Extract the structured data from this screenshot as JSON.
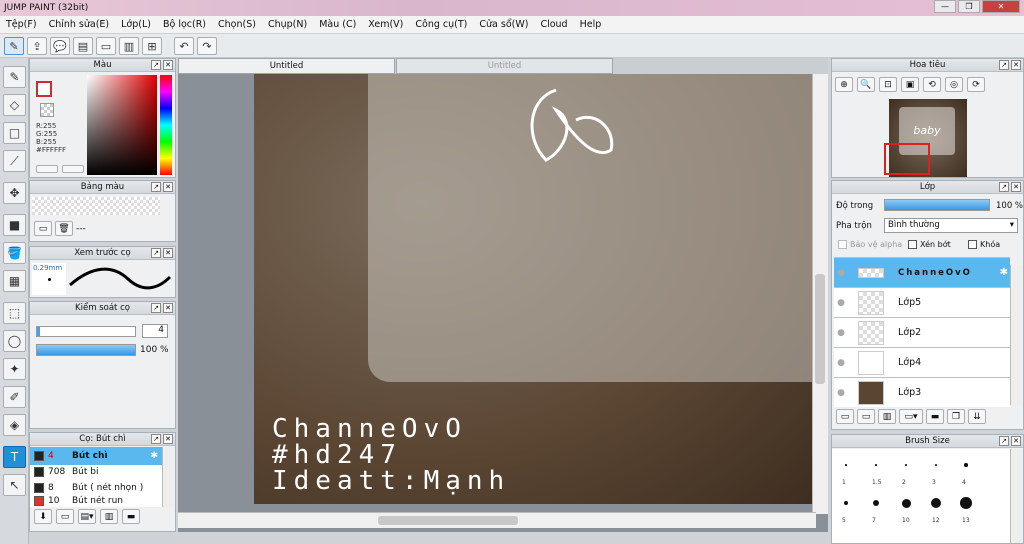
{
  "window": {
    "title": "JUMP PAINT (32bit)"
  },
  "menu": [
    "Tệp(F)",
    "Chỉnh sửa(E)",
    "Lớp(L)",
    "Bộ lọc(R)",
    "Chọn(S)",
    "Chụp(N)",
    "Màu (C)",
    "Xem(V)",
    "Công cụ(T)",
    "Cửa sổ(W)",
    "Cloud",
    "Help"
  ],
  "color_panel": {
    "title": "Màu",
    "r": "R:255",
    "g": "G:255",
    "b": "B:255",
    "hex": "#FFFFFF"
  },
  "palette_panel": {
    "title": "Bảng màu",
    "value": "---"
  },
  "preview_panel": {
    "title": "Xem trước cọ",
    "size": "0.29mm"
  },
  "control_panel": {
    "title": "Kiểm soát cọ",
    "size_value": "4",
    "opacity": "100 %",
    "opacity_level": 1.0
  },
  "brush_panel": {
    "title": "Cọ: Bút chì",
    "items": [
      {
        "num": "4",
        "name": "Bút chì",
        "color": "#222222",
        "active": true
      },
      {
        "num": "708",
        "name": "Bút bi",
        "color": "#222222"
      },
      {
        "num": "8",
        "name": "Bút ( nét nhọn )",
        "color": "#222222"
      },
      {
        "num": "10",
        "name": "Bút nét run",
        "color": "#e03030"
      }
    ]
  },
  "tabs": [
    "Untitled",
    "Untitled"
  ],
  "artwork": {
    "line1": "ChanneOvO",
    "line2": "#hd247",
    "line3": "Ideatt:Mạnh",
    "thumb_text": "baby"
  },
  "navigator": {
    "title": "Hoa tiêu"
  },
  "layers_panel": {
    "title": "Lớp",
    "opacity_label": "Độ trong",
    "opacity_value": "100 %",
    "opacity_level": 1.0,
    "blend_label": "Pha trộn",
    "blend_value": "Bình thường",
    "protect_alpha": "Bảo vệ alpha",
    "clip": "Xén bớt",
    "lock": "Khóa",
    "layers": [
      "ChanneOvO",
      "Lớp5",
      "Lớp2",
      "Lớp4",
      "Lớp3"
    ]
  },
  "brush_size": {
    "title": "Brush Size",
    "labels_row1": [
      "1",
      "1.5",
      "2",
      "3",
      "4"
    ],
    "labels_row2": [
      "5",
      "7",
      "10",
      "12",
      "13"
    ]
  }
}
